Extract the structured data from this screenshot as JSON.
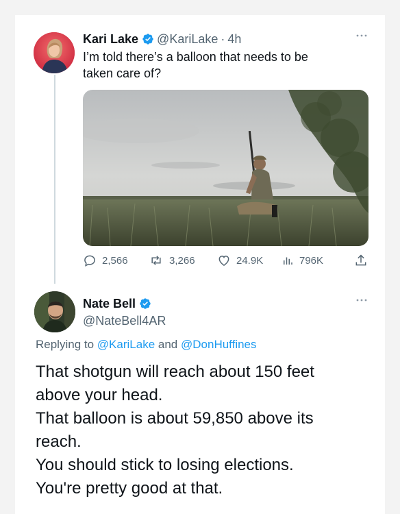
{
  "tweet": {
    "author_name": "Kari Lake",
    "handle": "@KariLake",
    "separator": "·",
    "time": "4h",
    "text_line1": "I’m told there’s a balloon that needs to be",
    "text_line2": "taken care of?",
    "media_icon": "photo-man-with-shotgun-in-field",
    "stats": {
      "replies": "2,566",
      "retweets": "3,266",
      "likes": "24.9K",
      "views": "796K"
    }
  },
  "reply": {
    "author_name": "Nate Bell",
    "handle": "@NateBell4AR",
    "replying_prefix": "Replying to",
    "mention1": "@KariLake",
    "and_word": "and",
    "mention2": "@DonHuffines",
    "lines": [
      "That shotgun will reach about 150 feet",
      "above your head.",
      "That balloon is about 59,850 above its",
      "reach.",
      "You should stick to losing elections.",
      "You're pretty good at that."
    ]
  },
  "colors": {
    "accent": "#1d9bf0",
    "text": "#0f1419",
    "muted": "#536471",
    "background": "#ffffff"
  }
}
